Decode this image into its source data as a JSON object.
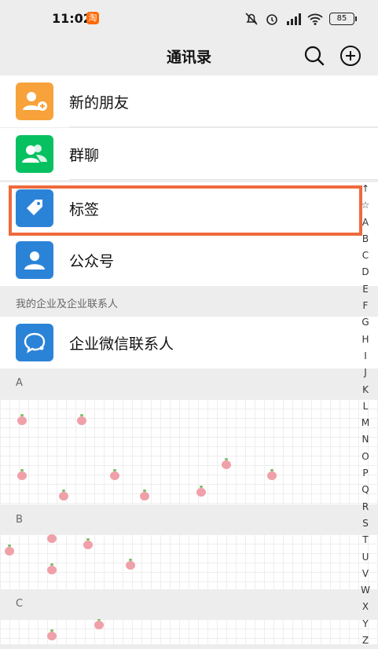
{
  "status": {
    "time": "11:02",
    "taobao": "淘",
    "battery": "85"
  },
  "navbar": {
    "title": "通讯录"
  },
  "items": [
    {
      "label": "新的朋友",
      "icon": "new-friend-icon",
      "color": "#f7a23a"
    },
    {
      "label": "群聊",
      "icon": "group-chat-icon",
      "color": "#07c160"
    },
    {
      "label": "标签",
      "icon": "tag-icon",
      "color": "#2b83d8"
    },
    {
      "label": "公众号",
      "icon": "official-account-icon",
      "color": "#2b83d8"
    }
  ],
  "enterprise": {
    "section": "我的企业及企业联系人",
    "label": "企业微信联系人"
  },
  "groups": [
    "A",
    "B",
    "C"
  ],
  "index": [
    "↑",
    "☆",
    "A",
    "B",
    "C",
    "D",
    "E",
    "F",
    "G",
    "H",
    "I",
    "J",
    "K",
    "L",
    "M",
    "N",
    "O",
    "P",
    "Q",
    "R",
    "S",
    "T",
    "U",
    "V",
    "W",
    "X",
    "Y",
    "Z"
  ]
}
